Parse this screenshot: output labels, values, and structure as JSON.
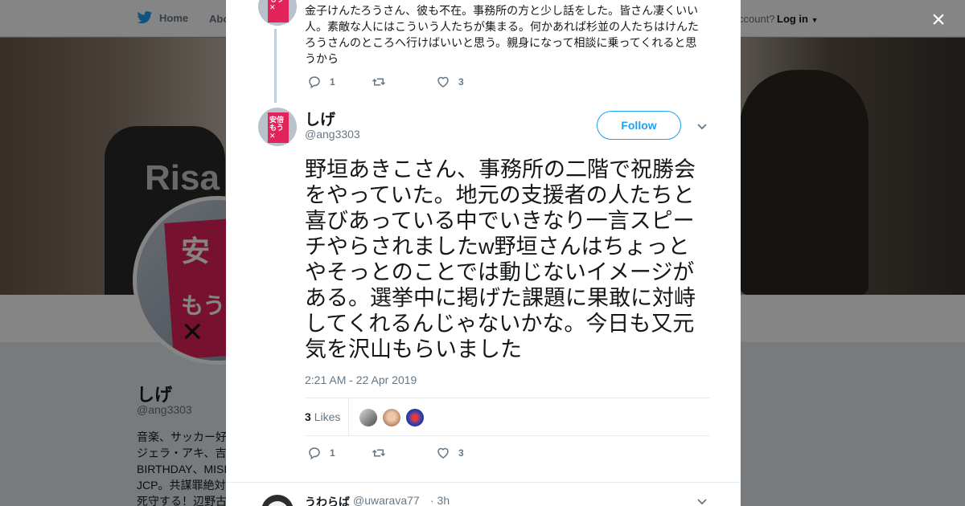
{
  "background": {
    "nav": {
      "home_label": "Home",
      "about_label": "Abo",
      "account_prompt": "ccount?",
      "login_label": "Log in"
    },
    "profile": {
      "name": "しげ",
      "handle": "@ang3303",
      "bio_lines": [
        "音楽、サッカー好",
        "ジェラ・アキ、吉",
        "BIRTHDAY、MISI",
        "JCP。共謀罪絶対",
        "死守する！辺野古"
      ]
    },
    "banner_shirt_text": "Risa"
  },
  "modal": {
    "close_icon": "×",
    "previous_tweet": {
      "text": "金子けんたろうさん、彼も不在。事務所の方と少し話をした。皆さん凄くいい人。素敵な人にはこういう人たちが集まる。何かあれば杉並の人たちはけんたろうさんのところへ行けばいいと思う。親身になって相談に乗ってくれると思うから",
      "reply_count": "1",
      "retweet_count": "",
      "like_count": "3"
    },
    "main_tweet": {
      "author_name": "しげ",
      "author_handle": "@ang3303",
      "follow_label": "Follow",
      "text": "野垣あきこさん、事務所の二階で祝勝会をやっていた。地元の支援者の人たちと喜びあっている中でいきなり一言スピーチやらされましたw野垣さんはちょっとやそっとのことでは動じないイメージがある。選挙中に掲げた課題に果敢に対峙してくれるんじゃないかな。今日も又元気を沢山もらいました",
      "timestamp": "2:21 AM - 22 Apr 2019",
      "likes_count": "3",
      "likes_label": "Likes",
      "reply_count": "1",
      "retweet_count": "",
      "like_count": "3"
    },
    "reply": {
      "name": "うわらば",
      "handle": "@uwarava77",
      "time": "· 3h"
    }
  },
  "colors": {
    "accent": "#1da1f2",
    "thread_line": "#a9d4f5",
    "muted_text": "#657786"
  }
}
